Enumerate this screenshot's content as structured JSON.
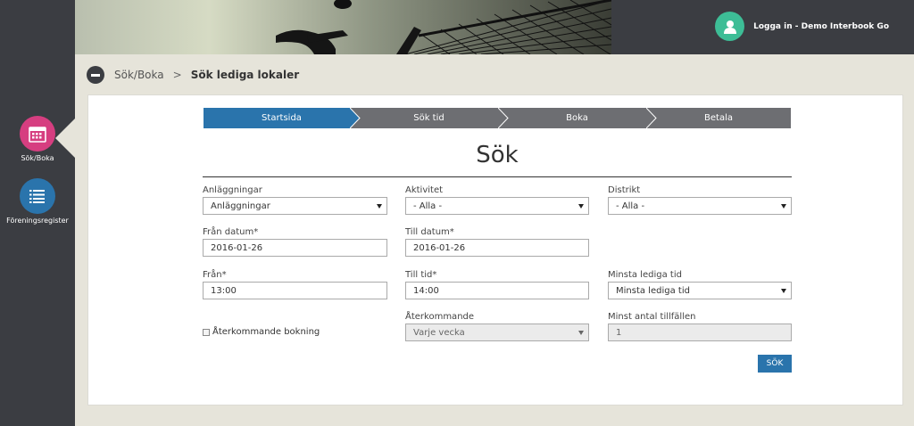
{
  "sidebar": {
    "items": [
      {
        "label": "Sök/Boka",
        "icon": "calendar-icon",
        "color": "#d63e80"
      },
      {
        "label": "Föreningsregister",
        "icon": "list-icon",
        "color": "#2a74ac"
      }
    ]
  },
  "header": {
    "user_label": "Logga in - Demo Interbook Go",
    "avatar_icon": "user-icon",
    "avatar_color": "#3dbd96"
  },
  "breadcrumb": {
    "link": "Sök/Boka",
    "separator": ">",
    "current": "Sök lediga lokaler"
  },
  "steps": [
    {
      "label": "Startsida",
      "active": true
    },
    {
      "label": "Sök tid",
      "active": false
    },
    {
      "label": "Boka",
      "active": false
    },
    {
      "label": "Betala",
      "active": false
    }
  ],
  "colors": {
    "step_active": "#2a74ac",
    "step_inactive": "#6d6e72",
    "primary_button": "#2a74ac"
  },
  "form": {
    "title": "Sök",
    "anlaggningar": {
      "label": "Anläggningar",
      "value": "Anläggningar"
    },
    "aktivitet": {
      "label": "Aktivitet",
      "value": "- Alla -"
    },
    "distrikt": {
      "label": "Distrikt",
      "value": "- Alla -"
    },
    "fran_datum": {
      "label": "Från datum*",
      "value": "2016-01-26"
    },
    "till_datum": {
      "label": "Till datum*",
      "value": "2016-01-26"
    },
    "fran": {
      "label": "Från*",
      "value": "13:00"
    },
    "till_tid": {
      "label": "Till tid*",
      "value": "14:00"
    },
    "minsta_lediga_tid": {
      "label": "Minsta lediga tid",
      "value": "Minsta lediga tid"
    },
    "aterkommande_bokning": {
      "label": "Återkommande bokning",
      "checked": false
    },
    "aterkommande": {
      "label": "Återkommande",
      "value": "Varje vecka"
    },
    "minst_antal": {
      "label": "Minst antal tillfällen",
      "value": "1"
    },
    "search_button": "SÖK"
  }
}
